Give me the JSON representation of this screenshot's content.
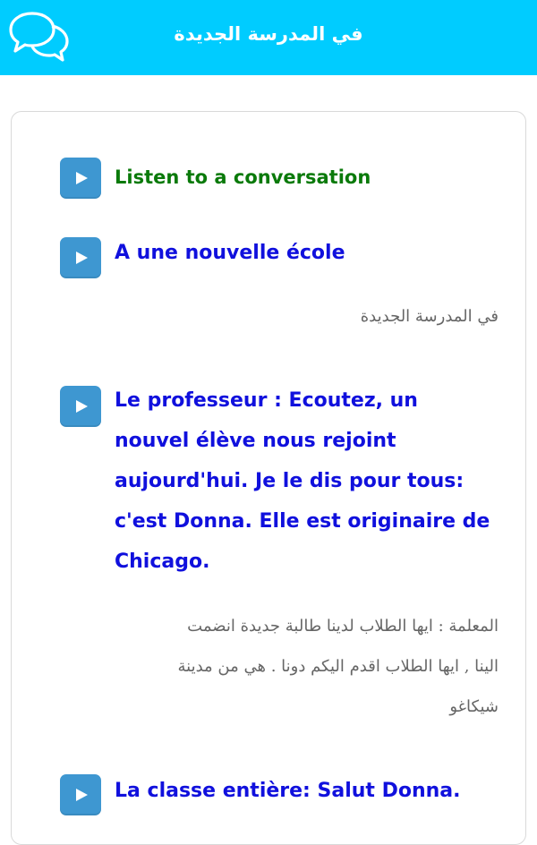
{
  "header": {
    "title": "في المدرسة الجديدة",
    "icon": "chat-bubbles-icon"
  },
  "colors": {
    "header_bg": "#00ccff",
    "play_button": "#3e97d1",
    "intro_text": "#0a7a0a",
    "phrase_text": "#1010dd",
    "translation_text": "#666666"
  },
  "lesson": {
    "intro": {
      "text": "Listen to a conversation",
      "icon": "play-icon"
    },
    "items": [
      {
        "phrase": "A une nouvelle école",
        "translation": "في المدرسة الجديدة",
        "icon": "play-icon"
      },
      {
        "phrase_lines": [
          "Le professeur : Ecoutez, un",
          "nouvel élève nous rejoint",
          "aujourd'hui. Je le dis pour tous:",
          "c'est Donna. Elle est originaire de",
          "Chicago."
        ],
        "translation_lines": [
          "المعلمة : ايها الطلاب لدينا طالبة جديدة انضمت",
          "الينا , ايها الطلاب اقدم اليكم دونا . هي من مدينة",
          "شيكاغو"
        ],
        "icon": "play-icon"
      },
      {
        "phrase": "La classe entière: Salut Donna.",
        "icon": "play-icon"
      }
    ]
  }
}
